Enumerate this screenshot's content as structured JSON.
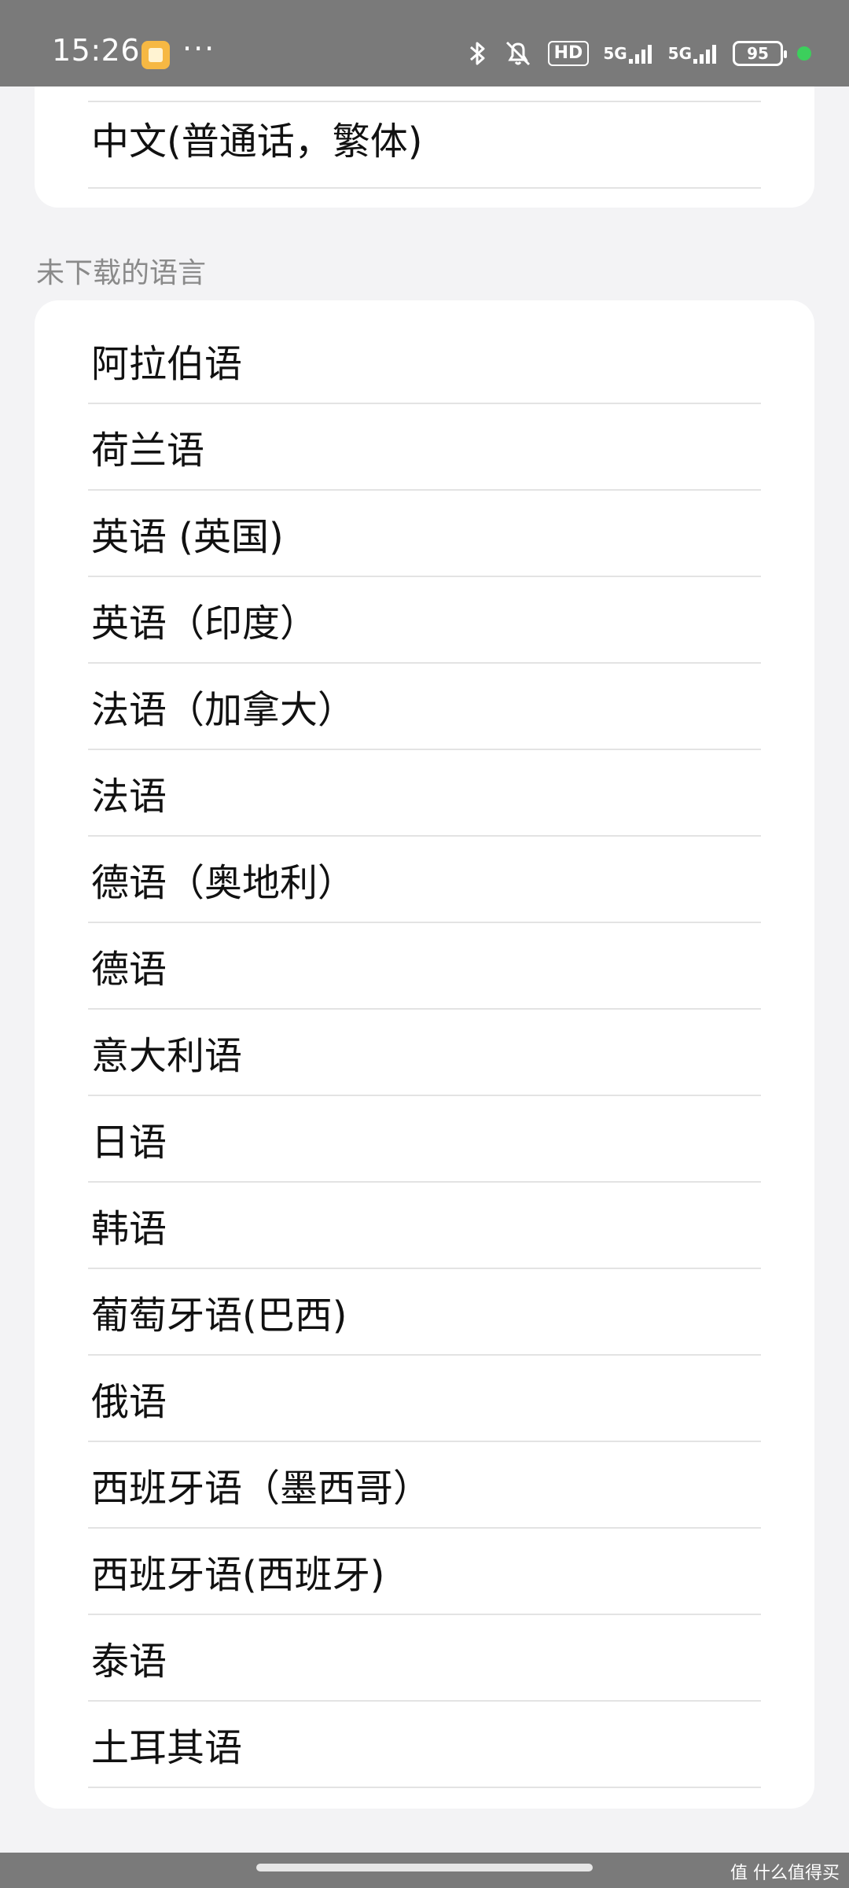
{
  "status_bar": {
    "time": "15:26",
    "more": "···",
    "bluetooth_icon": "bluetooth-icon",
    "mute_icon": "bell-off-icon",
    "hd_label": "HD",
    "network_1": "5G",
    "network_2": "5G",
    "battery_level": "95"
  },
  "top_card": {
    "item": "中文(普通话，繁体)"
  },
  "section_header": "未下载的语言",
  "languages": [
    "阿拉伯语",
    "荷兰语",
    "英语 (英国)",
    "英语（印度）",
    "法语（加拿大）",
    "法语",
    "德语（奥地利）",
    "德语",
    "意大利语",
    "日语",
    "韩语",
    "葡萄牙语(巴西)",
    "俄语",
    "西班牙语（墨西哥）",
    "西班牙语(西班牙)",
    "泰语",
    "土耳其语"
  ],
  "watermark": "值 什么值得买",
  "colors": {
    "status_bar": "#7a7a7a",
    "background": "#f3f3f5",
    "card": "#ffffff",
    "battery_dot": "#3ccf5c"
  }
}
